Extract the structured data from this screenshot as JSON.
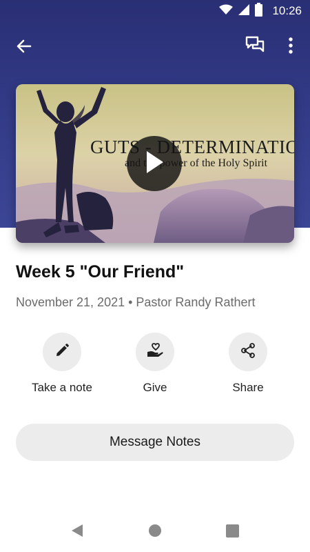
{
  "status_bar": {
    "time": "10:26",
    "icons": [
      "wifi-icon",
      "cell-signal-icon",
      "battery-icon"
    ]
  },
  "app_bar": {
    "icons": [
      "back-arrow-icon",
      "chat-icon",
      "more-vert-icon"
    ]
  },
  "video": {
    "slide_title": "GUTS - DETERMINATION",
    "slide_subtitle": "and the power of the Holy Spirit",
    "play_icon": "play-icon"
  },
  "message": {
    "title": "Week 5 \"Our Friend\"",
    "meta": "November 21, 2021 • Pastor Randy Rathert"
  },
  "actions": [
    {
      "label": "Take a note",
      "icon": "pencil-icon"
    },
    {
      "label": "Give",
      "icon": "give-heart-hand-icon"
    },
    {
      "label": "Share",
      "icon": "share-icon"
    }
  ],
  "notes_button": {
    "label": "Message Notes"
  },
  "nav_bar": {
    "icons": [
      "nav-back-icon",
      "nav-home-icon",
      "nav-recents-icon"
    ]
  },
  "colors": {
    "hero_background": "#323a86",
    "button_background": "#ececed",
    "secondary_text": "#6b6b6b"
  }
}
